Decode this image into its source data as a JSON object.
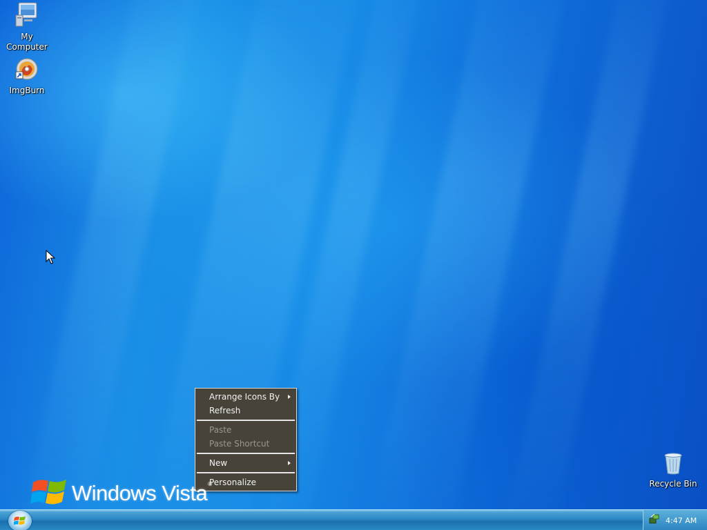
{
  "desktop": {
    "icons": [
      {
        "label_line1": "My",
        "label_line2": "Computer",
        "icon": "computer-icon"
      },
      {
        "label": "ImgBurn",
        "icon": "imgburn-disc-icon"
      },
      {
        "label": "Recycle Bin",
        "icon": "recycle-bin-icon"
      }
    ]
  },
  "context_menu": {
    "items": [
      {
        "label": "Arrange Icons By",
        "enabled": true,
        "submenu": true
      },
      {
        "label": "Refresh",
        "enabled": true,
        "submenu": false
      },
      {
        "label": "Paste",
        "enabled": false,
        "submenu": false
      },
      {
        "label": "Paste Shortcut",
        "enabled": false,
        "submenu": false
      },
      {
        "label": "New",
        "enabled": true,
        "submenu": true
      },
      {
        "label": "Personalize",
        "enabled": true,
        "submenu": false
      }
    ]
  },
  "branding": {
    "logo_text": "Windows Vista",
    "trademark": "®"
  },
  "taskbar": {
    "start_icon": "windows-orb-icon",
    "tray_icon": "network-icon",
    "clock": "4:47 AM"
  },
  "colors": {
    "menu_background": "#474338",
    "menu_text": "#f2f2f2",
    "menu_disabled_text": "#9a978d",
    "desktop_blue": "#1a8fe6",
    "taskbar_blue": "#2a87c4"
  }
}
